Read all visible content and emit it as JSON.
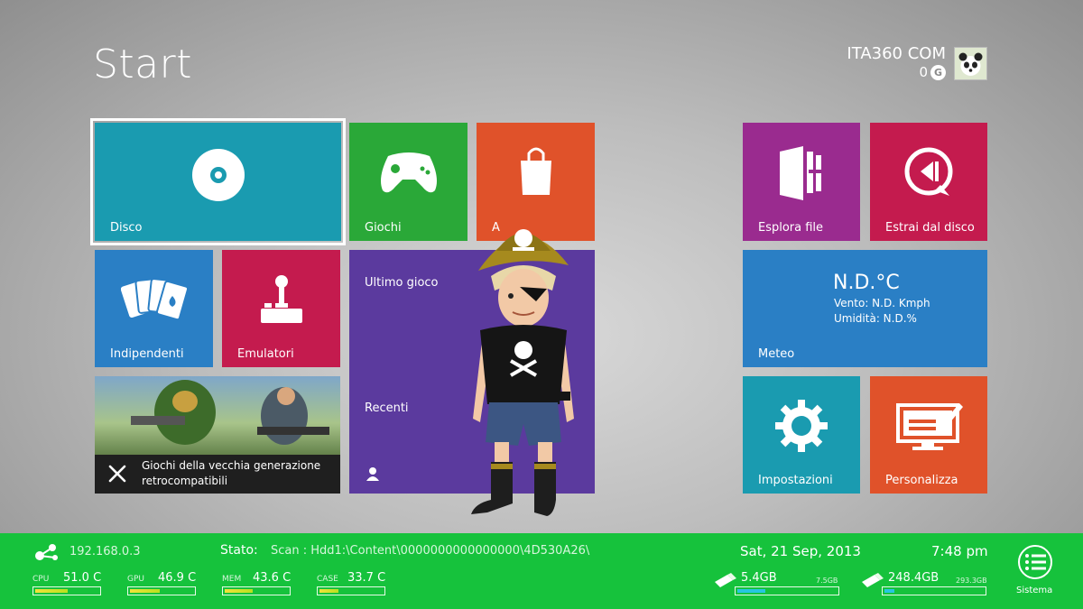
{
  "header": {
    "title": "Start"
  },
  "profile": {
    "gamertag": "ITA360 COM",
    "gamerscore": "0",
    "gamerscore_icon": "G"
  },
  "tiles": {
    "disco": "Disco",
    "giochi": "Giochi",
    "app": "A",
    "indipendenti": "Indipendenti",
    "emulatori": "Emulatori",
    "ultimo_gioco": "Ultimo gioco",
    "recenti": "Recenti",
    "banner_caption": "Giochi della vecchia generazione retrocompatibili",
    "esplora_file": "Esplora file",
    "estrai_disco": "Estrai dal disco",
    "meteo": "Meteo",
    "impostazioni": "Impostazioni",
    "personalizza": "Personalizza"
  },
  "weather": {
    "temp": "N.D.°C",
    "wind": "Vento: N.D. Kmph",
    "humidity": "Umidità: N.D.%"
  },
  "status": {
    "ip": "192.168.0.3",
    "stato_label": "Stato:",
    "stato_value": "Scan : Hdd1:\\Content\\0000000000000000\\4D530A26\\",
    "date": "Sat, 21 Sep, 2013",
    "time": "7:48 pm",
    "menu_label": "Sistema",
    "meters": [
      {
        "label": "CPU",
        "value": "51.0 C",
        "level": 0.51
      },
      {
        "label": "GPU",
        "value": "46.9 C",
        "level": 0.47
      },
      {
        "label": "MEM",
        "value": "43.6 C",
        "level": 0.44
      },
      {
        "label": "CASE",
        "value": "33.7 C",
        "level": 0.3
      }
    ],
    "drives": [
      {
        "free": "5.4GB",
        "total": "7.5GB",
        "level": 0.28
      },
      {
        "free": "248.4GB",
        "total": "293.3GB",
        "level": 0.1
      }
    ]
  },
  "colors": {
    "disco": "#1a9bb0",
    "giochi": "#2aa838",
    "app": "#e0522a",
    "indipendenti": "#2a7fc5",
    "emulatori": "#c41b4e",
    "recenti": "#5b3a9e",
    "esplora": "#9a2b8f",
    "estrai": "#c41b4e",
    "meteo": "#2a7fc5",
    "impostazioni": "#1a9bb0",
    "personalizza": "#e0522a",
    "statusbar": "#16c23c"
  }
}
